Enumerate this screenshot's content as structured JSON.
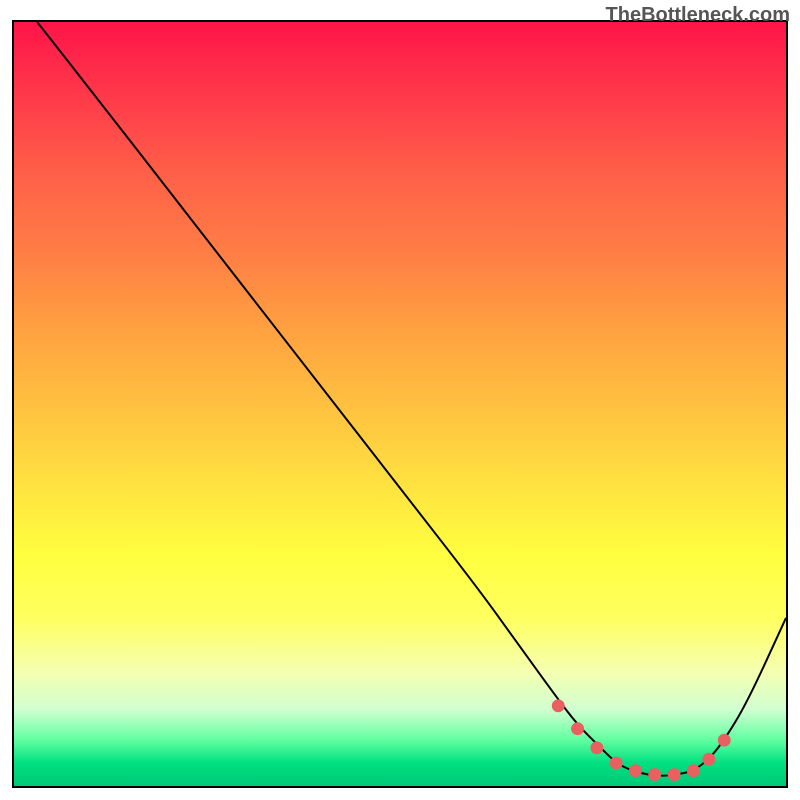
{
  "watermark": "TheBottleneck.com",
  "chart_data": {
    "type": "line",
    "title": "",
    "xlabel": "",
    "ylabel": "",
    "xlim": [
      0,
      100
    ],
    "ylim": [
      0,
      100
    ],
    "x": [
      3,
      10,
      20,
      30,
      40,
      50,
      60,
      65,
      70,
      73,
      76,
      78,
      80,
      82,
      84,
      86,
      88,
      90,
      92,
      95,
      100
    ],
    "values": [
      100,
      91,
      78,
      65,
      52,
      39,
      26,
      19,
      12,
      8,
      5,
      3,
      2,
      1.5,
      1.3,
      1.5,
      2,
      3.5,
      6,
      11,
      22
    ],
    "markers": {
      "x": [
        70.5,
        73,
        75.5,
        78,
        80.5,
        83,
        85.5,
        88,
        90,
        92
      ],
      "y": [
        10.5,
        7.5,
        5,
        3,
        2,
        1.5,
        1.5,
        2,
        3.5,
        6
      ]
    },
    "gradient": {
      "top_color": "#ff1448",
      "bottom_color": "#00c878",
      "meaning": "red-high to green-low bottleneck"
    }
  }
}
